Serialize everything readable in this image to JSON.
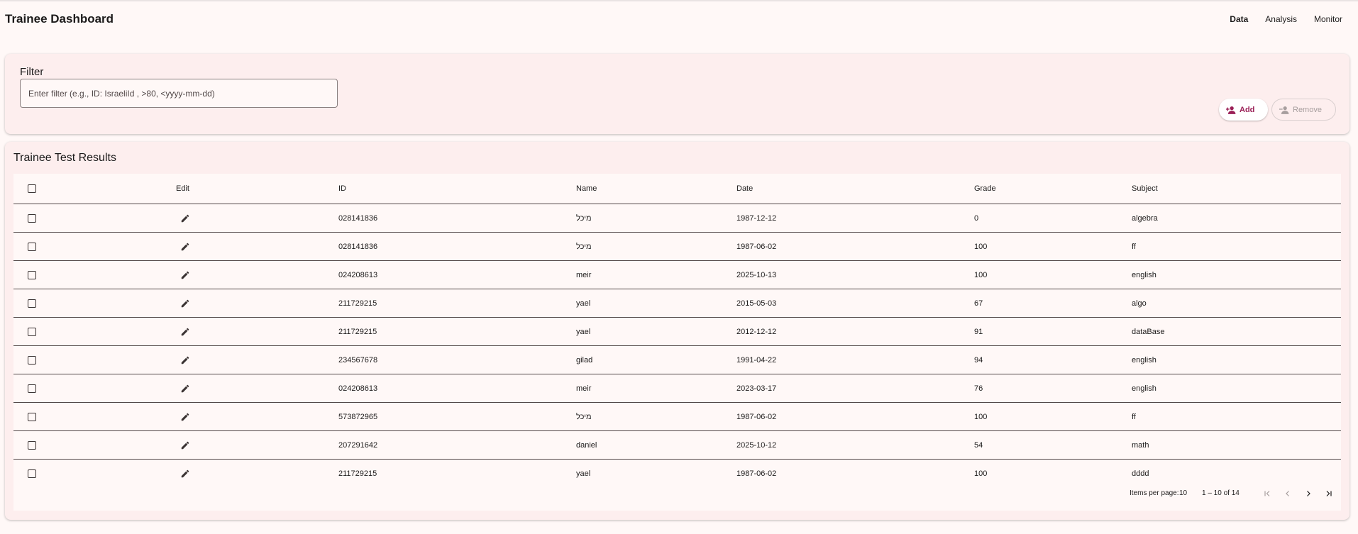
{
  "header": {
    "title": "Trainee Dashboard",
    "nav": [
      {
        "label": "Data",
        "active": true
      },
      {
        "label": "Analysis",
        "active": false
      },
      {
        "label": "Monitor",
        "active": false
      }
    ]
  },
  "filter": {
    "label": "Filter",
    "placeholder": "Enter filter (e.g., ID: IsraeliId , >80, <yyyy-mm-dd)",
    "value": "",
    "add_label": "Add",
    "remove_label": "Remove"
  },
  "table": {
    "title": "Trainee Test Results",
    "columns": [
      "Edit",
      "ID",
      "Name",
      "Date",
      "Grade",
      "Subject"
    ],
    "rows": [
      {
        "id": "028141836",
        "name": "מיכל",
        "date": "1987-12-12",
        "grade": "0",
        "subject": "algebra"
      },
      {
        "id": "028141836",
        "name": "מיכל",
        "date": "1987-06-02",
        "grade": "100",
        "subject": "ff"
      },
      {
        "id": "024208613",
        "name": "meir",
        "date": "2025-10-13",
        "grade": "100",
        "subject": "english"
      },
      {
        "id": "211729215",
        "name": "yael",
        "date": "2015-05-03",
        "grade": "67",
        "subject": "algo"
      },
      {
        "id": "211729215",
        "name": "yael",
        "date": "2012-12-12",
        "grade": "91",
        "subject": "dataBase"
      },
      {
        "id": "234567678",
        "name": "gilad",
        "date": "1991-04-22",
        "grade": "94",
        "subject": "english"
      },
      {
        "id": "024208613",
        "name": "meir",
        "date": "2023-03-17",
        "grade": "76",
        "subject": "english"
      },
      {
        "id": "573872965",
        "name": "מיכל",
        "date": "1987-06-02",
        "grade": "100",
        "subject": "ff"
      },
      {
        "id": "207291642",
        "name": "daniel",
        "date": "2025-10-12",
        "grade": "54",
        "subject": "math"
      },
      {
        "id": "211729215",
        "name": "yael",
        "date": "1987-06-02",
        "grade": "100",
        "subject": "dddd"
      }
    ]
  },
  "paginator": {
    "items_per_page_label": "Items per page:",
    "items_per_page": "10",
    "range": "1 – 10 of 14"
  },
  "colors": {
    "accent": "#9a1f56",
    "background": "#fff8f7",
    "card": "#fdeeee"
  }
}
